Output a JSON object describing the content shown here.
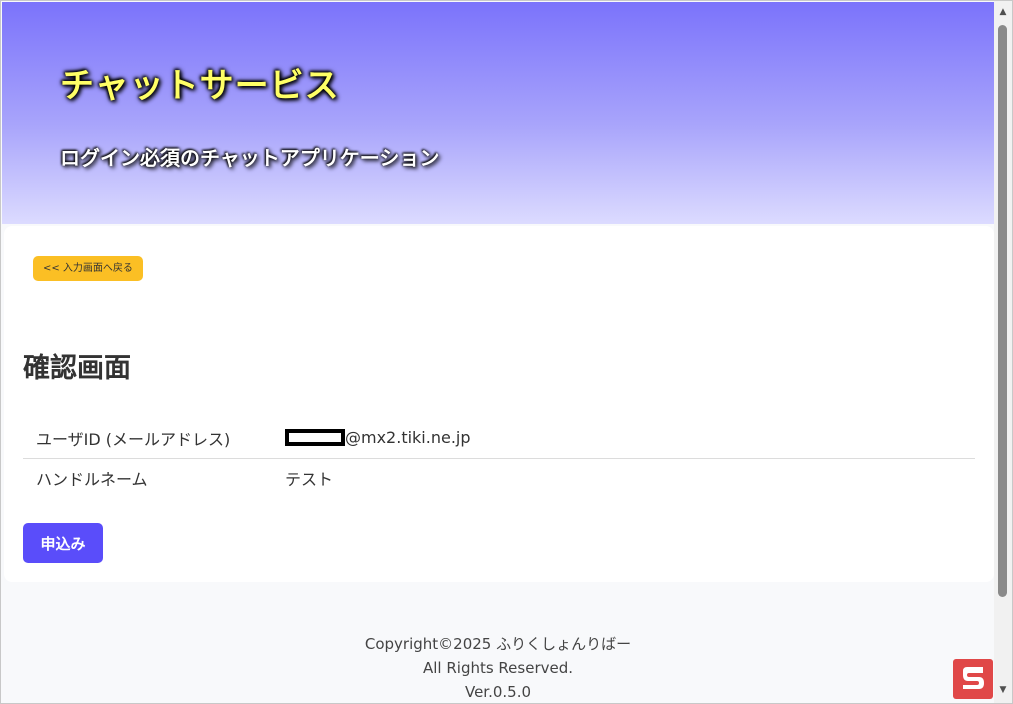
{
  "header": {
    "title": "チャットサービス",
    "subtitle": "ログイン必須のチャットアプリケーション"
  },
  "actions": {
    "back_label": "<< 入力画面へ戻る",
    "submit_label": "申込み"
  },
  "main": {
    "page_title": "確認画面",
    "rows": [
      {
        "label": "ユーザID (メールアドレス)",
        "value": "@mx2.tiki.ne.jp"
      },
      {
        "label": "ハンドルネーム",
        "value": "テスト"
      }
    ]
  },
  "footer": {
    "copyright": "Copyright©2025 ふりくしょんりばー",
    "rights": "All Rights Reserved.",
    "version": "Ver.0.5.0"
  },
  "colors": {
    "header_top": "#7b73fb",
    "title_text": "#ffff66",
    "back_button": "#fbbf24",
    "submit_button": "#5a4dfa"
  },
  "icons": {
    "scroll_up": "scroll-up-arrow-icon",
    "scroll_down": "scroll-down-arrow-icon",
    "app": "app-logo-icon"
  }
}
